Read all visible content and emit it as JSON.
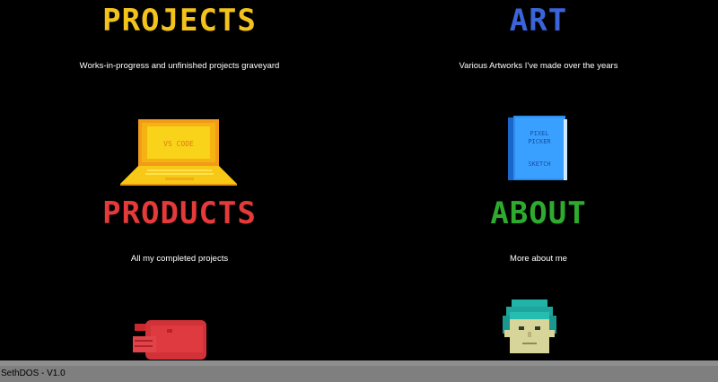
{
  "tiles": {
    "projects": {
      "title": "PROJECTS",
      "description": "Works-in-progress and unfinished projects graveyard",
      "color": "#f3c31b",
      "icon": "laptop-icon",
      "icon_text": "VS CODE"
    },
    "art": {
      "title": "ART",
      "description": "Various Artworks I've made over the years",
      "color": "#3a64d8",
      "icon": "sketchbook-icon",
      "icon_text_top": "PIXEL",
      "icon_text_mid": "PICKER",
      "icon_text_bottom": "SKETCH"
    },
    "products": {
      "title": "PRODUCTS",
      "description": "All my completed projects",
      "color": "#e53a3a",
      "icon": "cat-icon"
    },
    "about": {
      "title": "ABOUT",
      "description": "More about me",
      "color": "#2eab2e",
      "icon": "avatar-icon"
    }
  },
  "taskbar": {
    "label": "SethDOS - V1.0"
  }
}
